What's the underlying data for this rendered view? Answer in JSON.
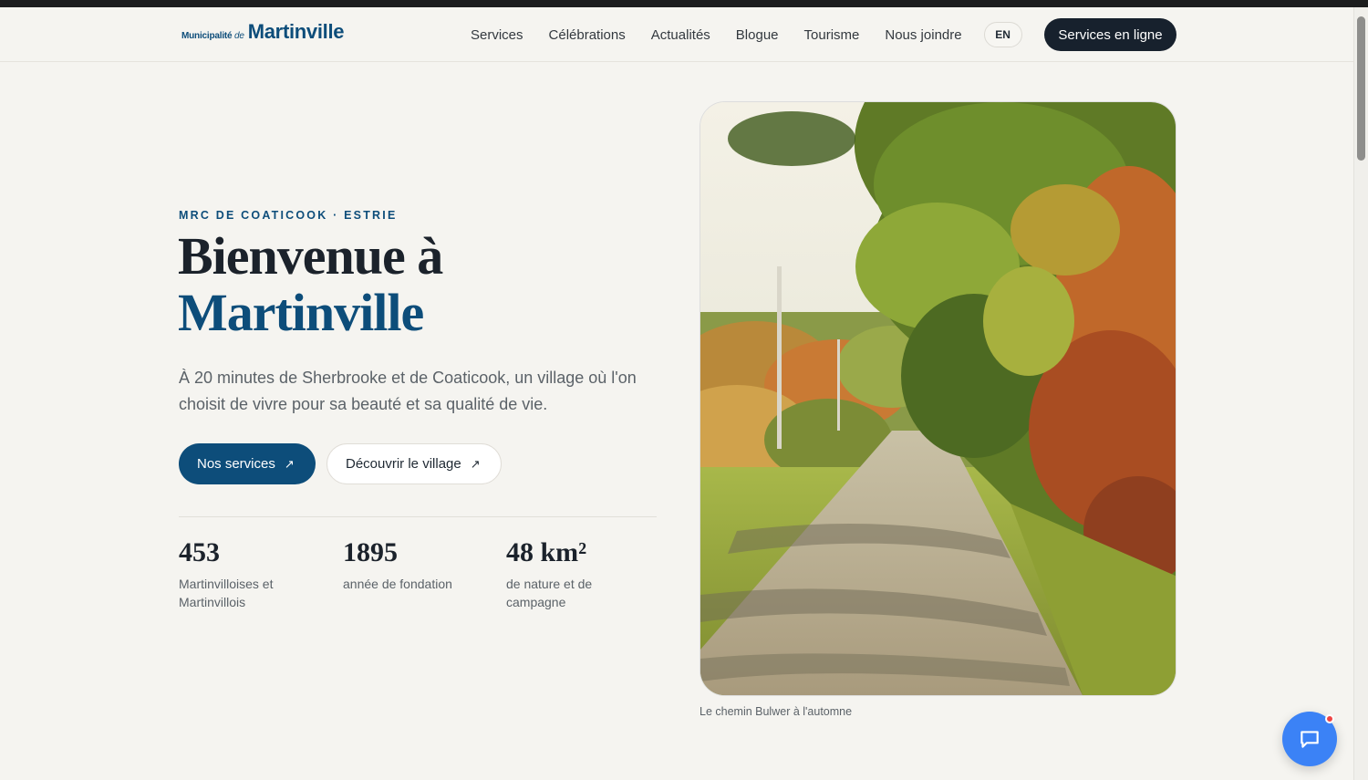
{
  "header": {
    "logo": {
      "prefix": "Municipalité",
      "prefix_de": "de",
      "name": "Martinville"
    },
    "nav": [
      "Services",
      "Célébrations",
      "Actualités",
      "Blogue",
      "Tourisme",
      "Nous joindre"
    ],
    "lang_label": "EN",
    "cta_label": "Services en ligne"
  },
  "hero": {
    "eyebrow": "MRC DE COATICOOK · ESTRIE",
    "title_line1": "Bienvenue à",
    "title_line2": "Martinville",
    "lead": "À 20 minutes de Sherbrooke et de Coaticook, un village où l'on choisit de vivre pour sa beauté et sa qualité de vie.",
    "primary_button": "Nos services",
    "secondary_button": "Découvrir le village",
    "stats": [
      {
        "value": "453",
        "label": "Martinvilloises et Martinvillois"
      },
      {
        "value": "1895",
        "label": "année de fondation"
      },
      {
        "value": "48 km²",
        "label": "de nature et de campagne"
      }
    ],
    "photo_caption": "Le chemin Bulwer à l'automne"
  },
  "icons": {
    "button_arrow": "arrow-up-right-icon",
    "chat": "chat-bubble-icon"
  },
  "colors": {
    "brand": "#0d4d7a",
    "dark": "#17212d",
    "background": "#f5f4f0",
    "chat": "#3b82f6",
    "notification": "#ef4444"
  }
}
